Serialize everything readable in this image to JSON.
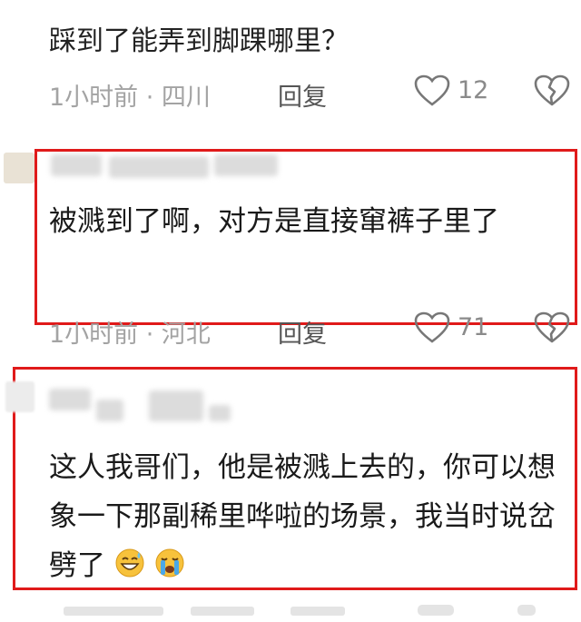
{
  "comments": [
    {
      "text": "踩到了能弄到脚踝哪里？",
      "time_location": "1小时前 · 四川",
      "reply_label": "回复",
      "likes": "12"
    },
    {
      "text": "被溅到了啊，对方是直接窜裤子里了",
      "time_location": "1小时前 · 河北",
      "reply_label": "回复",
      "likes": "71"
    },
    {
      "text": "这人我哥们，他是被溅上去的，你可以想象一下那副稀里哗啦的场景，我当时说岔劈了",
      "emoji": [
        "grinning-sweat-emoji",
        "crying-emoji"
      ]
    }
  ],
  "highlight_color": "#e01a1a"
}
